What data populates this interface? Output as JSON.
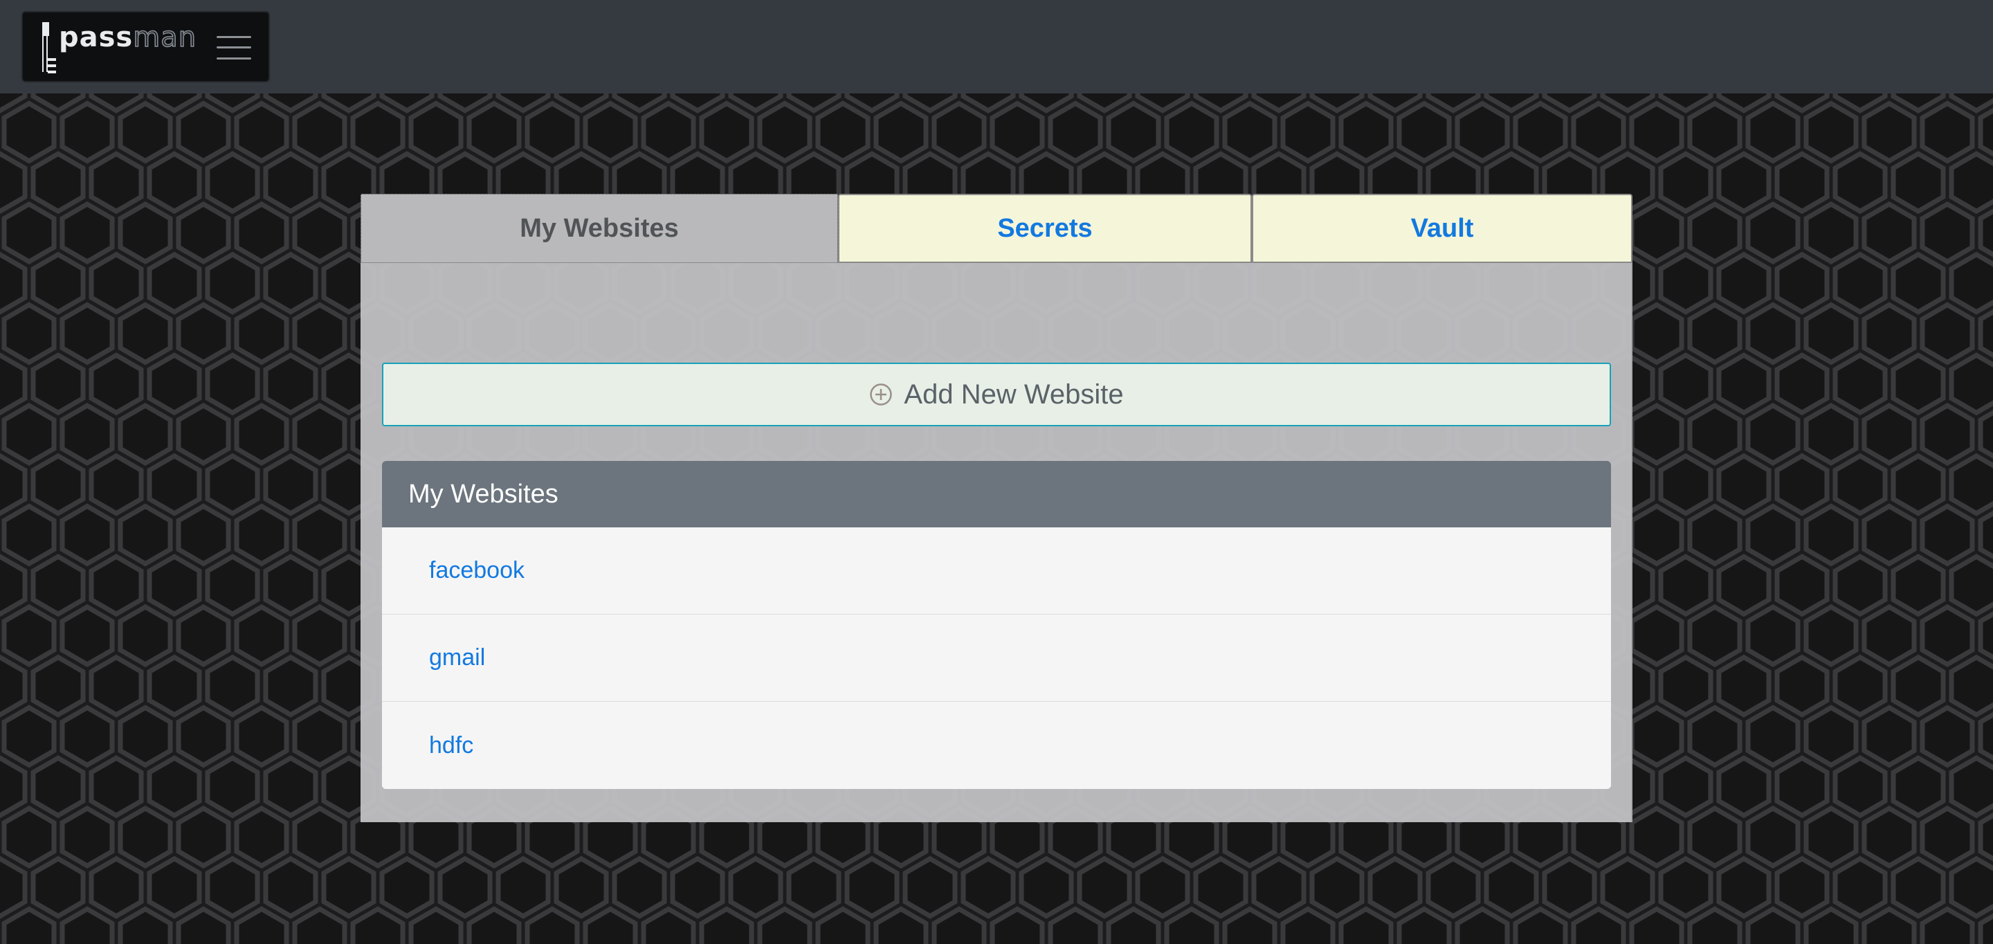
{
  "navbar": {
    "logo": {
      "text_bold": "pass",
      "text_outline": "man",
      "icon": "key-icon"
    },
    "menu_icon": "hamburger-menu-icon"
  },
  "tabs": [
    {
      "label": "My Websites",
      "active": true
    },
    {
      "label": "Secrets",
      "active": false
    },
    {
      "label": "Vault",
      "active": false
    }
  ],
  "add_button": {
    "label": "Add New Website",
    "icon": "plus-circle-icon"
  },
  "websites_card": {
    "header": "My Websites",
    "items": [
      "facebook",
      "gmail",
      "hdfc"
    ]
  },
  "colors": {
    "navbar_bg": "#343a40",
    "tab_active_bg": "#b9b9bc",
    "tab_inactive_bg": "#f5f5d9",
    "link": "#1279e0",
    "card_header_bg": "#6c757d",
    "add_button_border": "#17a2b8",
    "add_button_bg": "#e7efe7"
  }
}
